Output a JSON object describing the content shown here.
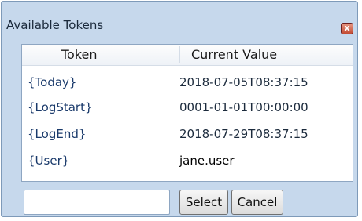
{
  "window": {
    "title": "Available Tokens",
    "close_icon": "close-icon",
    "close_glyph": "x"
  },
  "grid": {
    "columns": [
      "Token",
      "Current Value"
    ],
    "rows": [
      {
        "token": "{Today}",
        "value": "2018-07-05T08:37:15"
      },
      {
        "token": "{LogStart}",
        "value": "0001-01-01T00:00:00"
      },
      {
        "token": "{LogEnd}",
        "value": "2018-07-29T08:37:15"
      },
      {
        "token": "{User}",
        "value": "jane.user"
      }
    ]
  },
  "footer": {
    "input_value": "",
    "select_label": "Select",
    "cancel_label": "Cancel"
  },
  "colors": {
    "window_bg": "#c6d8ec",
    "close_button": "#c24a32"
  }
}
